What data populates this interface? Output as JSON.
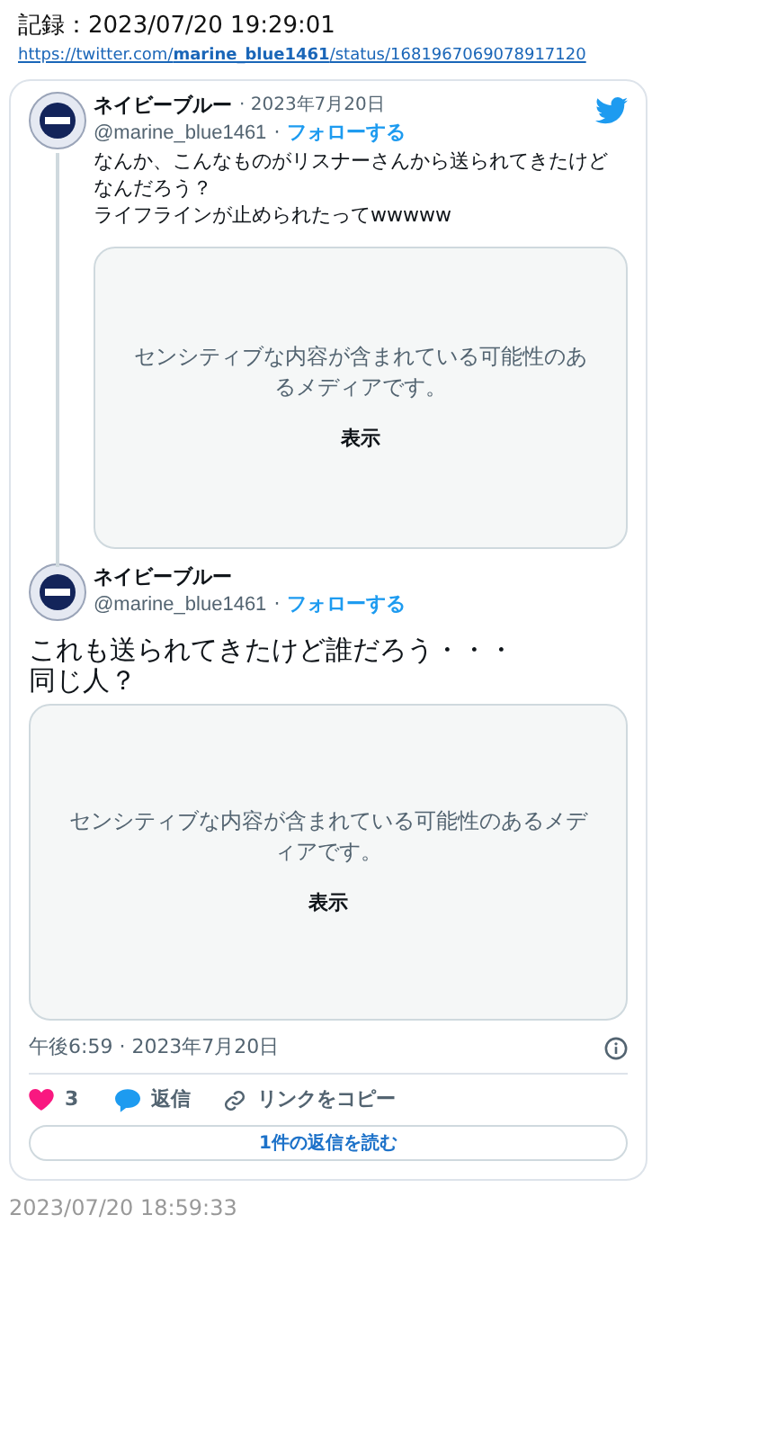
{
  "record": {
    "label": "記録：2023/07/20 19:29:01",
    "url": "https://twitter.com/**marine_blue1461**/status/1681967069078917120"
  },
  "quoted_tweet": {
    "name": "ネイビーブルー",
    "date": "· 2023年7月20日",
    "handle": "@marine_blue1461",
    "separator": "·",
    "follow": "フォローする",
    "text": [
      "なんか、こんなものがリスナーさんから送られてきたけどなんだろう？",
      "ライフラインが止められたってwwwww"
    ],
    "media": {
      "notice": "センシティブな内容が含まれている可能性のあるメディアです。",
      "show": "表示"
    }
  },
  "main_tweet": {
    "name": "ネイビーブルー",
    "handle": "@marine_blue1461",
    "separator": "·",
    "follow": "フォローする",
    "text": [
      "これも送られてきたけど誰だろう・・・",
      "同じ人？"
    ],
    "media": {
      "notice": "センシティブな内容が含まれている可能性のあるメディアです。",
      "show": "表示"
    },
    "timestamp": "午後6:59 · 2023年7月20日",
    "likes": "3",
    "reply": "返信",
    "copy_link": "リンクをコピー",
    "read_replies": "1件の返信を読む"
  },
  "archived_at": "2023/07/20 18:59:33"
}
